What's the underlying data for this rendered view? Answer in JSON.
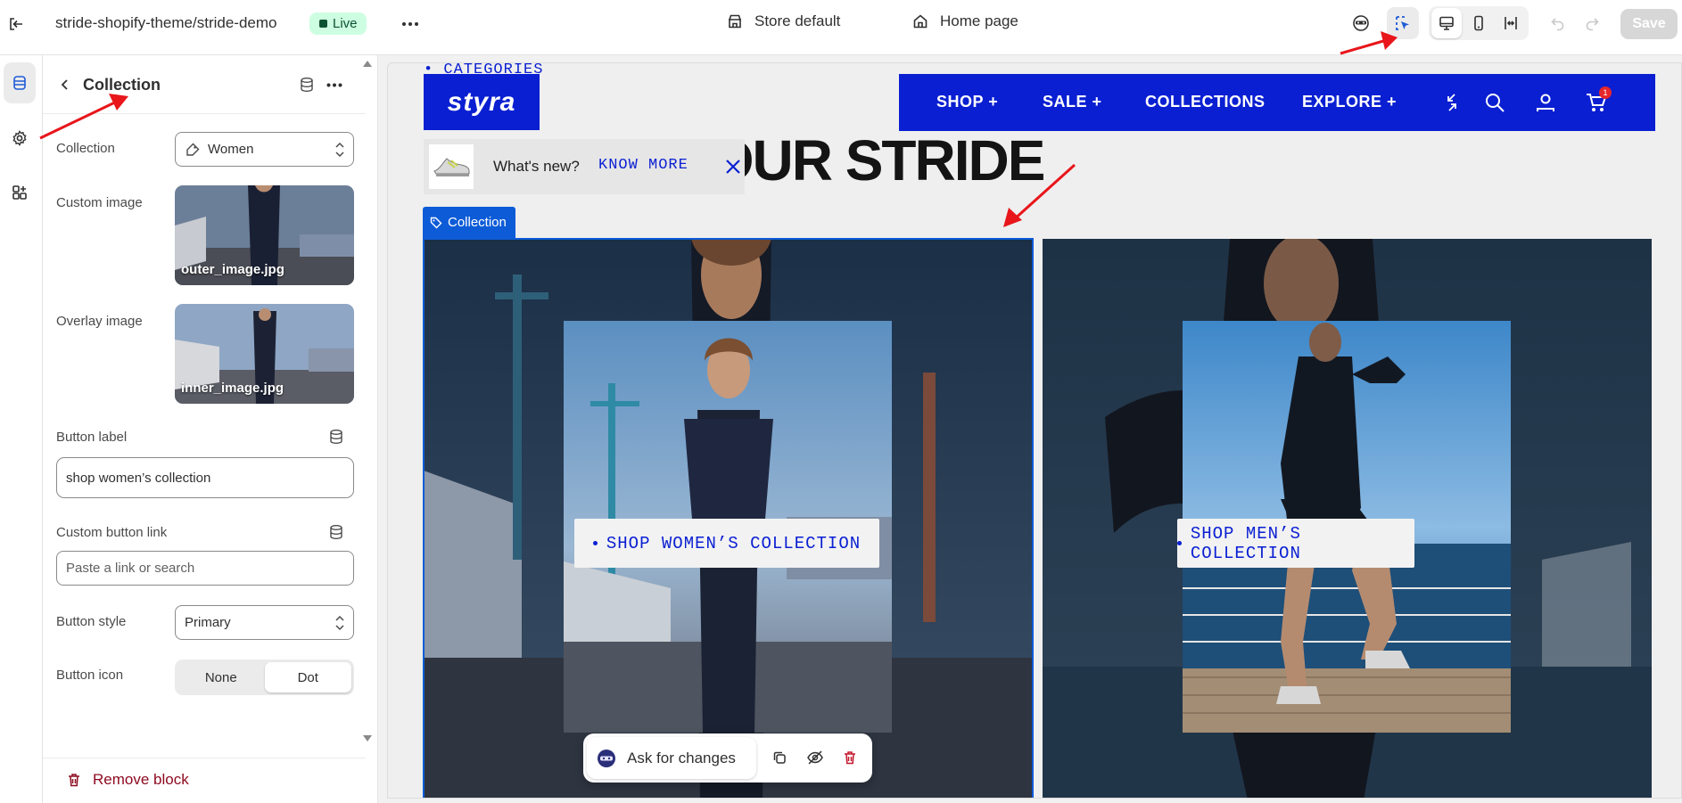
{
  "topbar": {
    "theme_name": "stride-shopify-theme/stride-demo",
    "live_label": "Live",
    "store_label": "Store default",
    "page_label": "Home page",
    "save_label": "Save"
  },
  "panel": {
    "title": "Collection",
    "fields": {
      "collection_label": "Collection",
      "collection_value": "Women",
      "custom_image_label": "Custom image",
      "custom_image_file": "outer_image.jpg",
      "overlay_image_label": "Overlay image",
      "overlay_image_file": "inner_image.jpg",
      "button_label_label": "Button label",
      "button_label_value": "shop women’s collection",
      "custom_link_label": "Custom button link",
      "custom_link_placeholder": "Paste a link or search",
      "button_style_label": "Button style",
      "button_style_value": "Primary",
      "button_icon_label": "Button icon",
      "button_icon_options": [
        "None",
        "Dot"
      ],
      "button_icon_selected": "Dot"
    },
    "remove_label": "Remove block"
  },
  "preview": {
    "categories_link": "• CATEGORIES",
    "heading": "CHOOSE YOUR STRIDE",
    "logo": "styra",
    "nav": [
      "SHOP +",
      "SALE +",
      "COLLECTIONS",
      "EXPLORE +"
    ],
    "cart_count": "1",
    "whats_new": "What's new?",
    "know_more": "KNOW MORE",
    "collection_tag": "Collection",
    "cards": [
      {
        "cta": "SHOP WOMEN’S COLLECTION"
      },
      {
        "cta": "SHOP MEN’S COLLECTION"
      }
    ],
    "ask_label": "Ask for changes"
  },
  "icons": {
    "exit": "exit-icon",
    "more": "ellipsis-icon",
    "store": "store-icon",
    "home": "home-icon",
    "inspector": "inspector-icon",
    "select": "select-element-icon",
    "desktop": "desktop-icon",
    "mobile": "mobile-icon",
    "fullscreen": "fullscreen-icon",
    "undo": "undo-icon",
    "redo": "redo-icon"
  },
  "colors": {
    "brand_blue": "#0a1fd2",
    "selection_blue": "#0d5bd7",
    "live_bg": "#cdfee1",
    "danger": "#8e0b21",
    "annotation_red": "#e8161b"
  }
}
